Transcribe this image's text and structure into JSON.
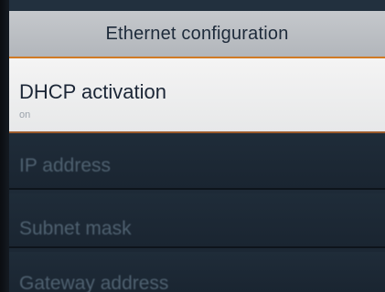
{
  "header": {
    "title": "Ethernet configuration"
  },
  "menu": {
    "items": [
      {
        "label": "DHCP activation",
        "value": "on",
        "selected": true
      },
      {
        "label": "IP address",
        "value": "",
        "selected": false
      },
      {
        "label": "Subnet mask",
        "value": "",
        "selected": false
      },
      {
        "label": "Gateway address",
        "value": "",
        "selected": false
      }
    ]
  },
  "colors": {
    "header_bg": "#bcc0c4",
    "accent_border": "#d07a24",
    "selected_bg": "#f0f0f0",
    "row_bg": "#1e2a36",
    "dim_text": "#4f6170"
  }
}
